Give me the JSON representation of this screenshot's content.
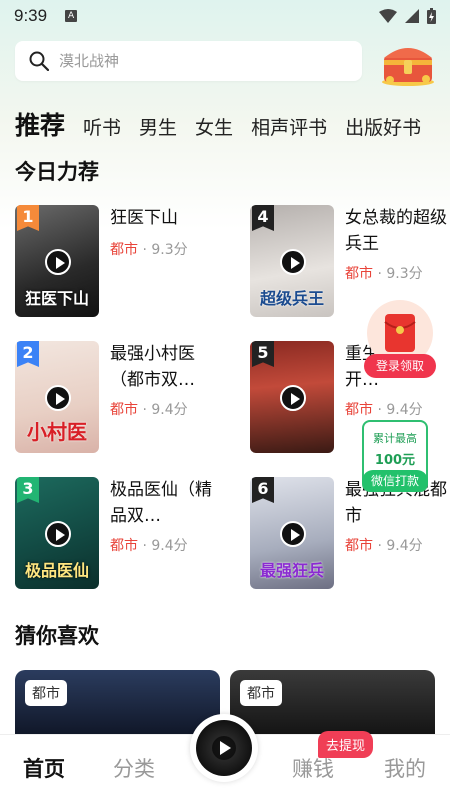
{
  "status": {
    "time": "9:39",
    "notif": "A"
  },
  "search": {
    "placeholder": "漠北战神"
  },
  "tabs": [
    "推荐",
    "听书",
    "男生",
    "女生",
    "相声评书",
    "出版好书"
  ],
  "sections": {
    "today": "今日力荐",
    "guess": "猜你喜欢"
  },
  "books": [
    {
      "rank": "1",
      "title": "狂医下山",
      "genre": "都市",
      "score": "9.3分",
      "cover_text": "狂医下山",
      "rank_color": "#f58a3a"
    },
    {
      "rank": "2",
      "title": "最强小村医（都市双…",
      "genre": "都市",
      "score": "9.4分",
      "cover_text": "小村医",
      "rank_color": "#3b82f6"
    },
    {
      "rank": "3",
      "title": "极品医仙（精品双…",
      "genre": "都市",
      "score": "9.4分",
      "cover_text": "极品医仙",
      "rank_color": "#22b573"
    },
    {
      "rank": "4",
      "title": "女总裁的超级兵王",
      "genre": "都市",
      "score": "9.3分",
      "cover_text": "超级兵王",
      "rank_color": "#222222"
    },
    {
      "rank": "5",
      "title": "重生1980：开…",
      "genre": "都市",
      "score": "9.4分",
      "cover_text": "",
      "rank_color": "#222222"
    },
    {
      "rank": "6",
      "title": "最强狂兵混都市",
      "genre": "都市",
      "score": "9.4分",
      "cover_text": "最强狂兵",
      "rank_color": "#222222"
    }
  ],
  "meta_sep": "·",
  "float_red": {
    "label": "登录领取"
  },
  "float_green": {
    "line1": "累计最高",
    "line2": "100元",
    "button": "微信打款"
  },
  "banners": [
    {
      "tag": "都市"
    },
    {
      "tag": "都市"
    }
  ],
  "nav": {
    "home": "首页",
    "category": "分类",
    "earn": "赚钱",
    "mine": "我的",
    "badge": "去提现"
  },
  "colors": {
    "accent_red": "#e8443a",
    "green": "#22c16b"
  }
}
